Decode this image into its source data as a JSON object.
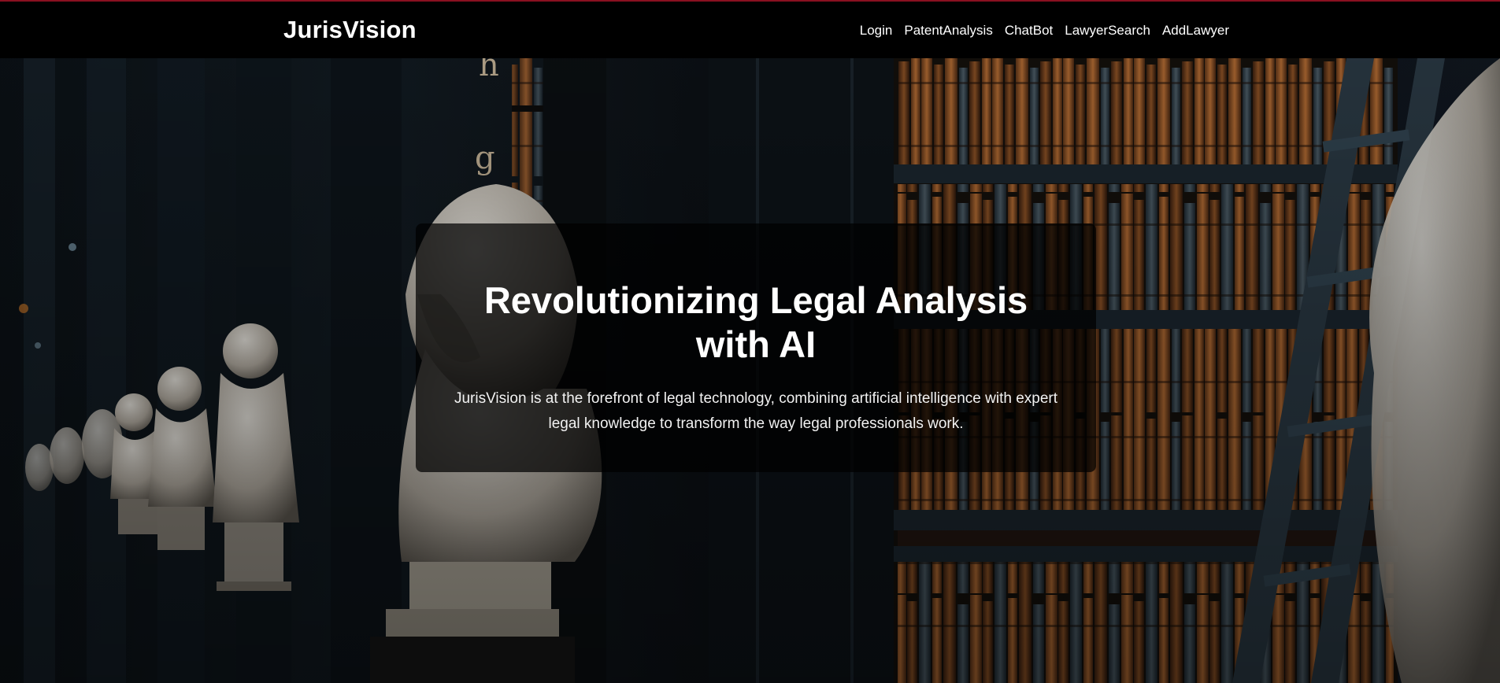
{
  "navbar": {
    "brand": "JurisVision",
    "links": [
      {
        "label": "Login"
      },
      {
        "label": "PatentAnalysis"
      },
      {
        "label": "ChatBot"
      },
      {
        "label": "LawyerSearch"
      },
      {
        "label": "AddLawyer"
      }
    ]
  },
  "hero": {
    "title": "Revolutionizing Legal Analysis with AI",
    "description": "JurisVision is at the forefront of legal technology, combining artificial intelligence with expert legal knowledge to transform the way legal professionals work.",
    "background_image": "library-busts-and-bookshelves"
  },
  "colors": {
    "navbar_bg": "#000000",
    "top_accent": "#8a1020",
    "text": "#ffffff"
  }
}
